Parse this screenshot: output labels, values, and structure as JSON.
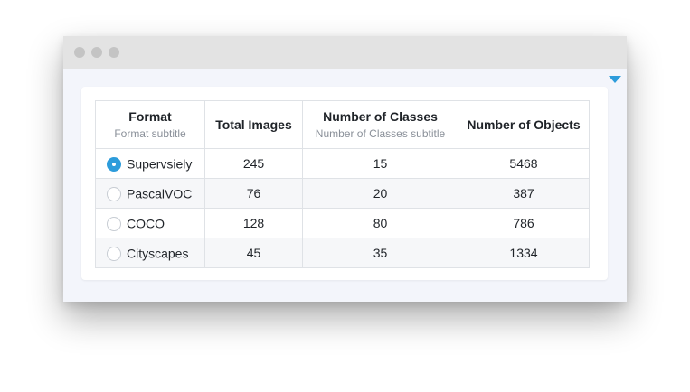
{
  "table": {
    "columns": [
      {
        "title": "Format",
        "subtitle": "Format subtitle"
      },
      {
        "title": "Total Images",
        "subtitle": ""
      },
      {
        "title": "Number of Classes",
        "subtitle": "Number of Classes subtitle"
      },
      {
        "title": "Number of Objects",
        "subtitle": ""
      }
    ],
    "rows": [
      {
        "format": "Supervsiely",
        "selected": true,
        "total_images": "245",
        "num_classes": "15",
        "num_objects": "5468"
      },
      {
        "format": "PascalVOC",
        "selected": false,
        "total_images": "76",
        "num_classes": "20",
        "num_objects": "387"
      },
      {
        "format": "COCO",
        "selected": false,
        "total_images": "128",
        "num_classes": "80",
        "num_objects": "786"
      },
      {
        "format": "Cityscapes",
        "selected": false,
        "total_images": "45",
        "num_classes": "35",
        "num_objects": "1334"
      }
    ]
  },
  "colors": {
    "accent": "#2d9cdb",
    "border": "#dfe2e6",
    "alt_row": "#f6f7f9"
  },
  "icons": {
    "collapse": "chevron-down-icon"
  }
}
